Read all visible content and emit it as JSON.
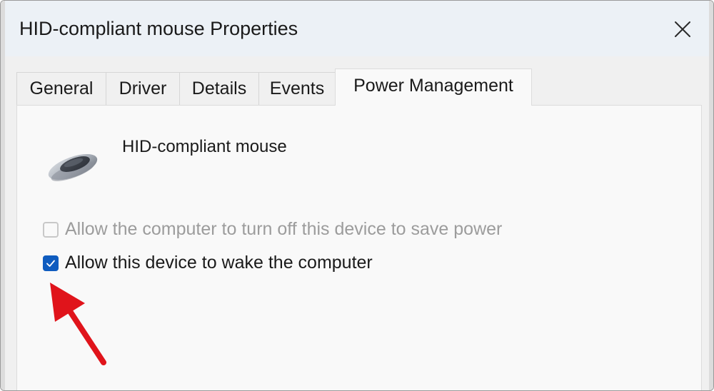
{
  "window": {
    "title": "HID-compliant mouse Properties",
    "close_icon": "close-icon"
  },
  "tabs": [
    {
      "label": "General",
      "active": false
    },
    {
      "label": "Driver",
      "active": false
    },
    {
      "label": "Details",
      "active": false
    },
    {
      "label": "Events",
      "active": false
    },
    {
      "label": "Power Management",
      "active": true
    }
  ],
  "device": {
    "name": "HID-compliant mouse",
    "icon": "mouse-icon"
  },
  "options": [
    {
      "label": "Allow the computer to turn off this device to save power",
      "checked": false,
      "enabled": false
    },
    {
      "label": "Allow this device to wake the computer",
      "checked": true,
      "enabled": true
    }
  ],
  "annotation": {
    "icon": "red-arrow-icon",
    "color": "#e0141b"
  },
  "colors": {
    "accent": "#0f5cbf",
    "titlebar": "#ecf1f6"
  }
}
